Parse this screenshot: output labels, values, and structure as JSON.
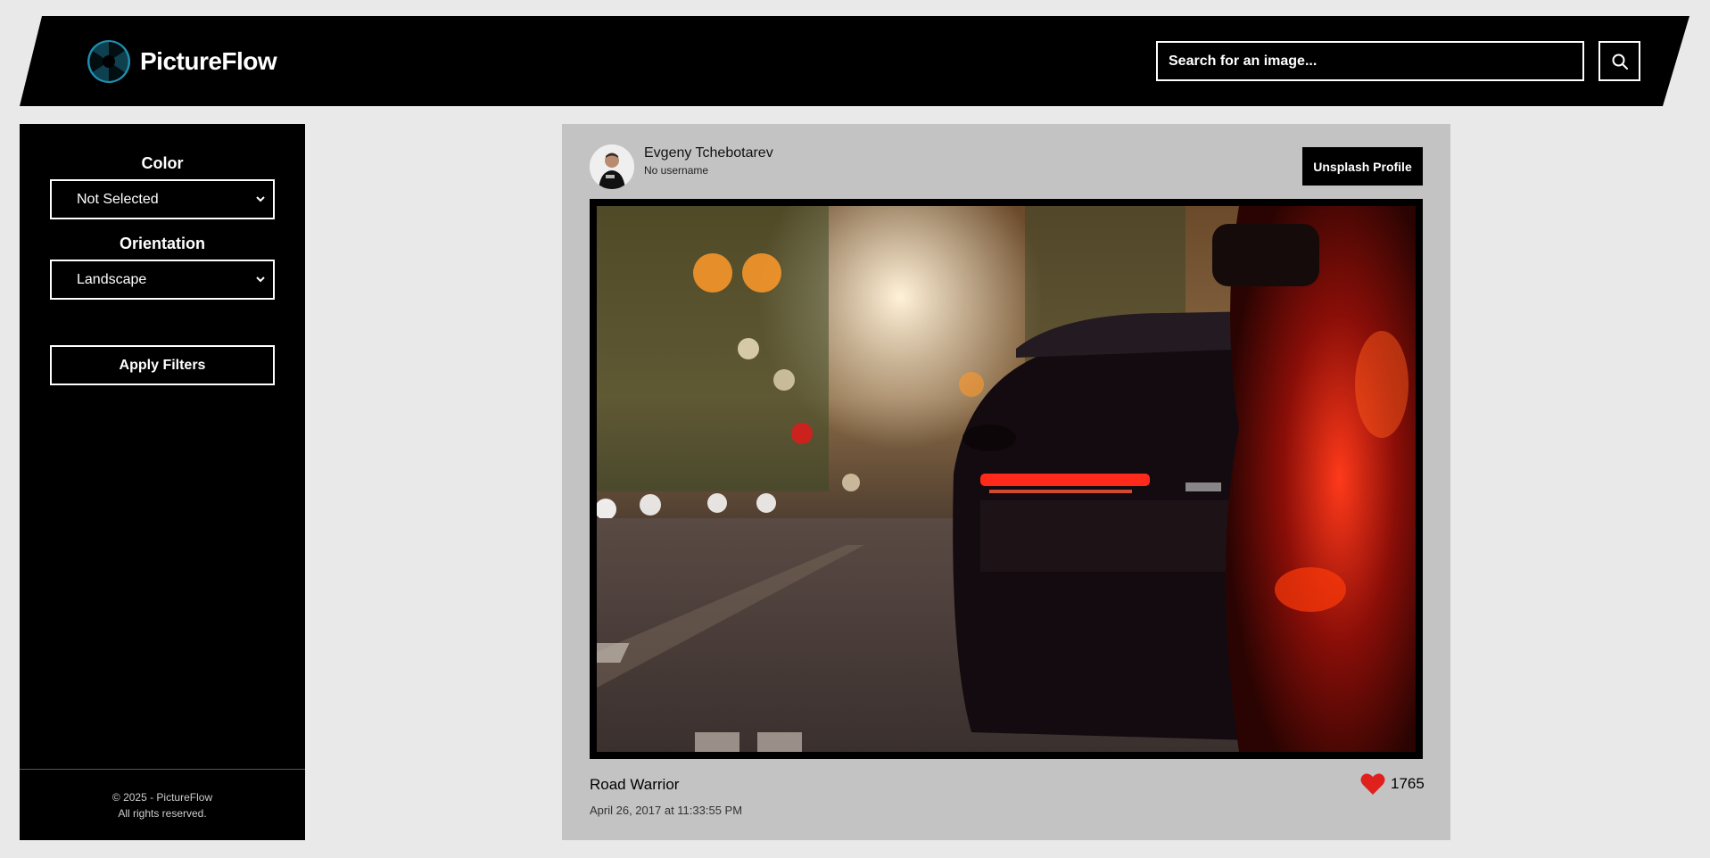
{
  "app": {
    "name": "PictureFlow"
  },
  "header": {
    "search_placeholder": "Search for an image...",
    "search_icon": "search-icon"
  },
  "sidebar": {
    "color_label": "Color",
    "color_value": "Not Selected",
    "orientation_label": "Orientation",
    "orientation_value": "Landscape",
    "apply_label": "Apply Filters",
    "footer_line1": "© 2025 - PictureFlow",
    "footer_line2": "All rights reserved."
  },
  "card": {
    "author_name": "Evgeny Tchebotarev",
    "author_username": "No username",
    "profile_button": "Unsplash Profile",
    "image_title": "Road Warrior",
    "image_date": "April 26, 2017 at 11:33:55 PM",
    "likes": "1765",
    "like_icon": "heart-icon"
  },
  "colors": {
    "brand_teal": "#1f8fb0",
    "header_bg": "#000000",
    "page_bg": "#e9e9e9",
    "card_bg": "#c3c3c3",
    "heart": "#e0201c"
  }
}
